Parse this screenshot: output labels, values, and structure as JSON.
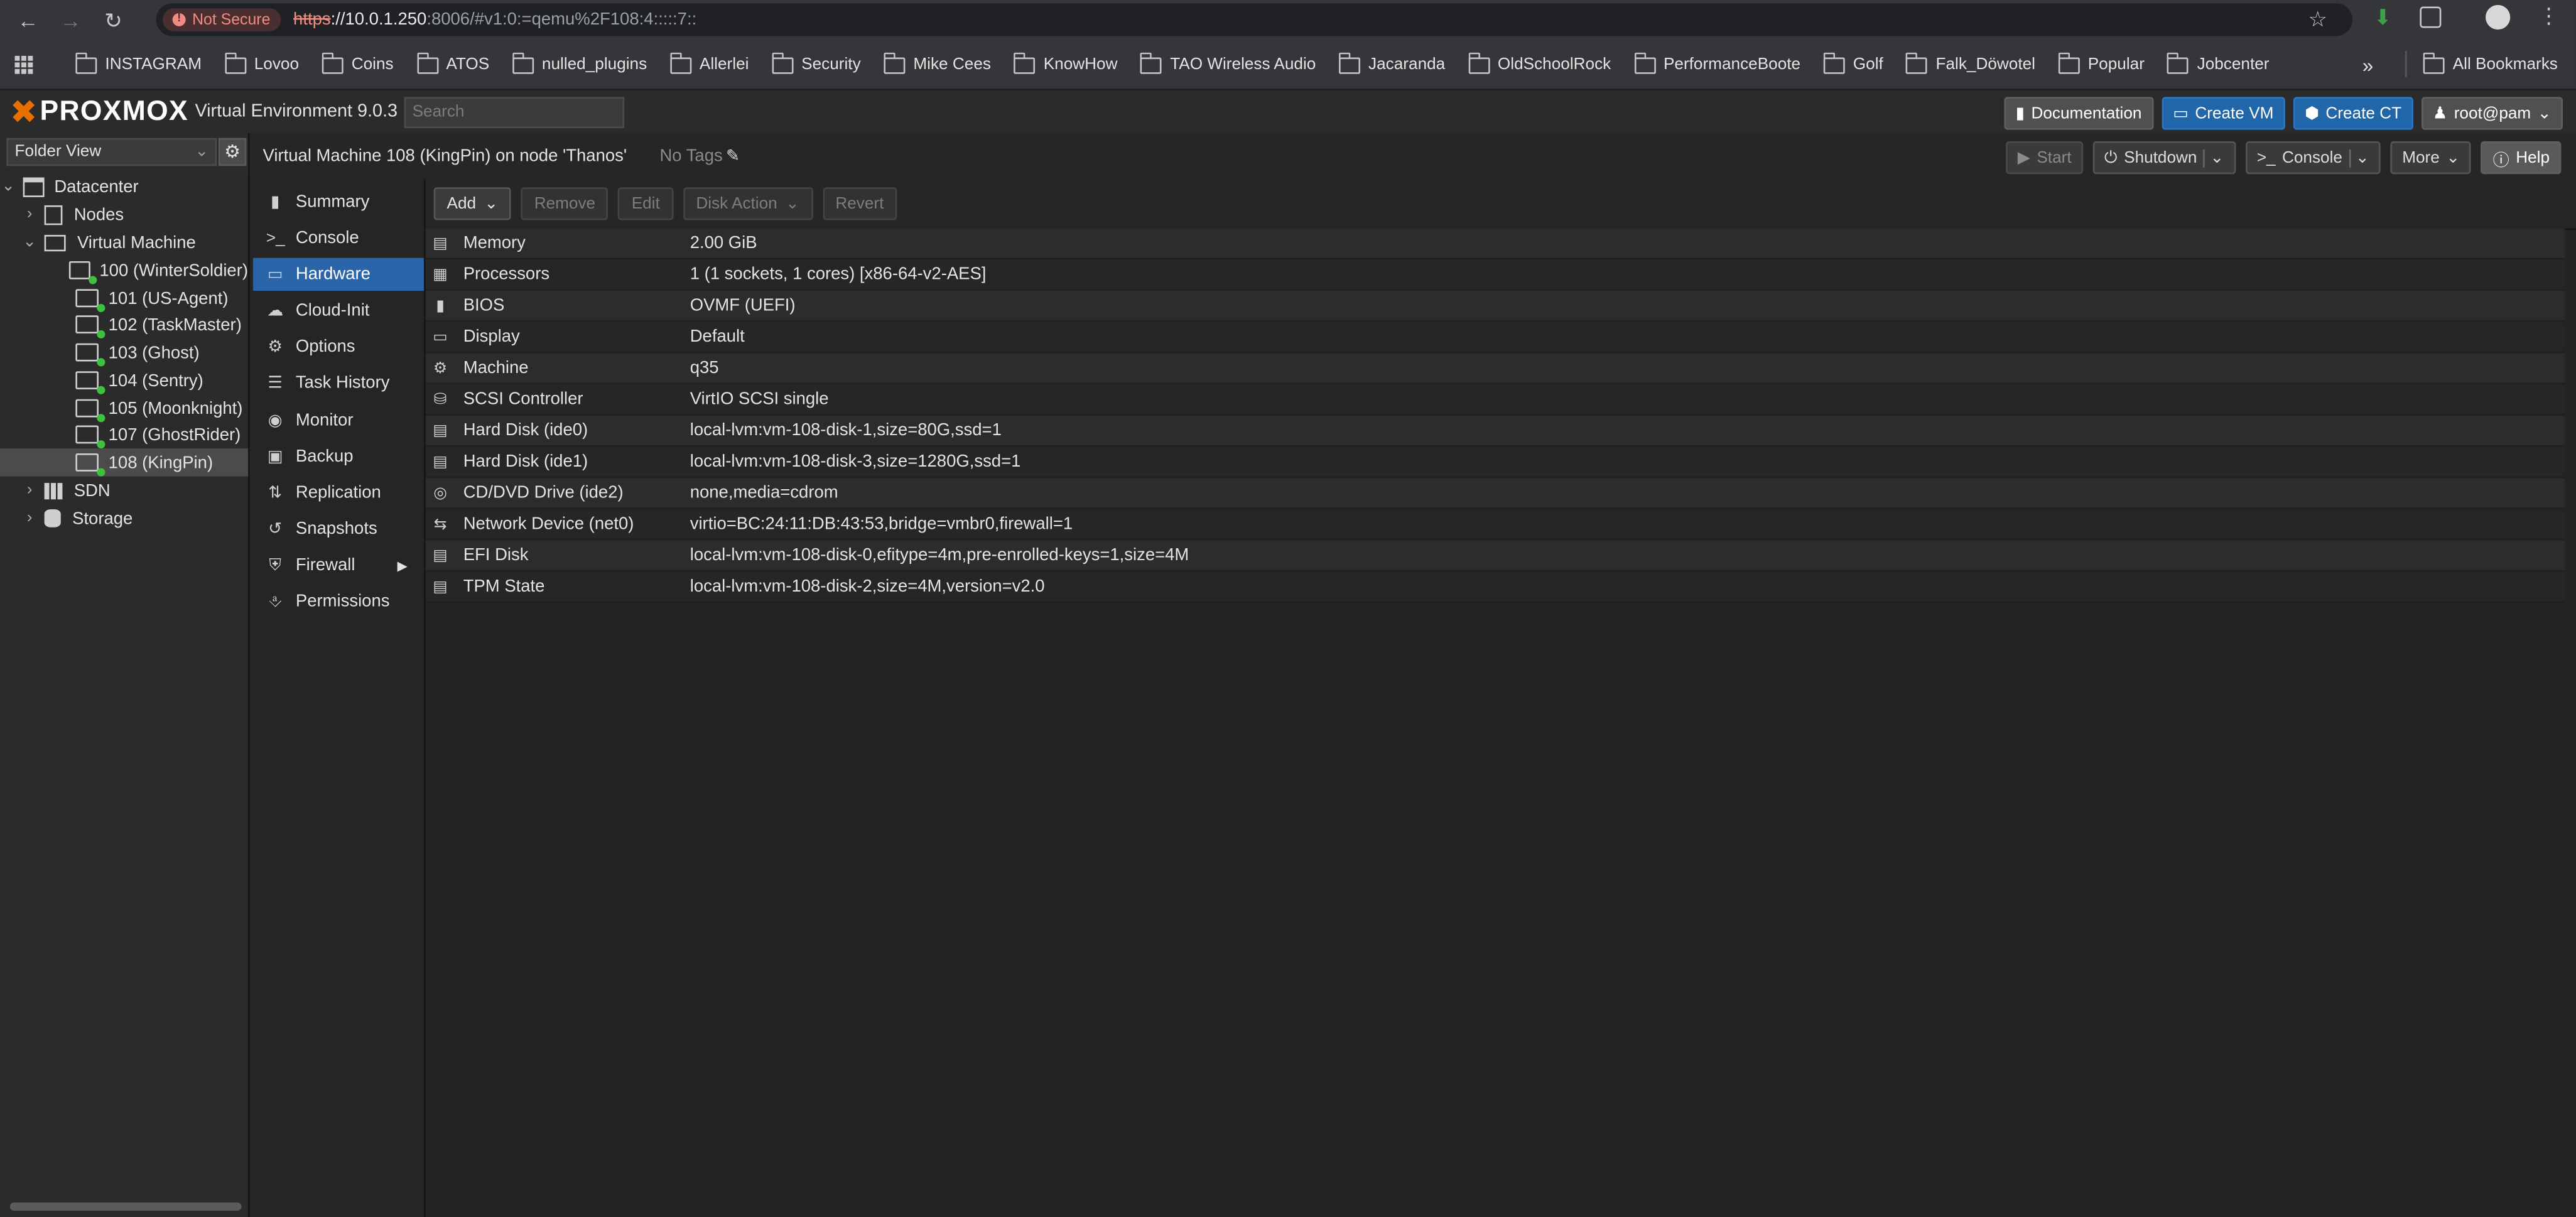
{
  "browser": {
    "security_chip": "Not Secure",
    "url_scheme": "https",
    "url_host": "://10.0.1.250",
    "url_rest": ":8006/#v1:0:=qemu%2F108:4:::::7::",
    "bookmarks": [
      "INSTAGRAM",
      "Lovoo",
      "Coins",
      "ATOS",
      "nulled_plugins",
      "Allerlei",
      "Security",
      "Mike Cees",
      "KnowHow",
      "TAO Wireless Audio",
      "Jacaranda",
      "OldSchoolRock",
      "PerformanceBoote",
      "Golf",
      "Falk_Döwotel",
      "Popular",
      "Jobcenter"
    ],
    "all_bookmarks": "All Bookmarks",
    "more_bookmarks": "»"
  },
  "header": {
    "logo": "PROXMOX",
    "product": "Virtual Environment 9.0.3",
    "search_placeholder": "Search",
    "documentation": "Documentation",
    "create_vm": "Create VM",
    "create_ct": "Create CT",
    "user": "root@pam"
  },
  "tree": {
    "view_select": "Folder View",
    "items": [
      {
        "label": "Datacenter"
      },
      {
        "label": "Nodes"
      },
      {
        "label": "Virtual Machine"
      },
      {
        "label": "100 (WinterSoldier)"
      },
      {
        "label": "101 (US-Agent)"
      },
      {
        "label": "102 (TaskMaster)"
      },
      {
        "label": "103 (Ghost)"
      },
      {
        "label": "104 (Sentry)"
      },
      {
        "label": "105 (Moonknight)"
      },
      {
        "label": "107 (GhostRider)"
      },
      {
        "label": "108 (KingPin)"
      },
      {
        "label": "SDN"
      },
      {
        "label": "Storage"
      }
    ]
  },
  "content": {
    "title": "Virtual Machine 108 (KingPin) on node 'Thanos'",
    "tags": "No Tags",
    "start": "Start",
    "shutdown": "Shutdown",
    "console": "Console",
    "more": "More",
    "help": "Help"
  },
  "menu": [
    {
      "label": "Summary",
      "icon": "book-icon"
    },
    {
      "label": "Console",
      "icon": "terminal-icon"
    },
    {
      "label": "Hardware",
      "icon": "monitor-icon"
    },
    {
      "label": "Cloud-Init",
      "icon": "cloud-icon"
    },
    {
      "label": "Options",
      "icon": "gear-icon"
    },
    {
      "label": "Task History",
      "icon": "list-icon"
    },
    {
      "label": "Monitor",
      "icon": "eye-icon"
    },
    {
      "label": "Backup",
      "icon": "floppy-icon"
    },
    {
      "label": "Replication",
      "icon": "retweet-icon"
    },
    {
      "label": "Snapshots",
      "icon": "history-icon"
    },
    {
      "label": "Firewall",
      "icon": "shield-icon"
    },
    {
      "label": "Permissions",
      "icon": "unlock-icon"
    }
  ],
  "toolbar": {
    "add": "Add",
    "remove": "Remove",
    "edit": "Edit",
    "disk_action": "Disk Action",
    "revert": "Revert"
  },
  "hardware": [
    {
      "name": "Memory",
      "value": "2.00 GiB",
      "icon": "memory-icon"
    },
    {
      "name": "Processors",
      "value": "1 (1 sockets, 1 cores) [x86-64-v2-AES]",
      "icon": "cpu-icon"
    },
    {
      "name": "BIOS",
      "value": "OVMF (UEFI)",
      "icon": "microchip-icon"
    },
    {
      "name": "Display",
      "value": "Default",
      "icon": "desktop-icon"
    },
    {
      "name": "Machine",
      "value": "q35",
      "icon": "cogs-icon"
    },
    {
      "name": "SCSI Controller",
      "value": "VirtIO SCSI single",
      "icon": "database-icon"
    },
    {
      "name": "Hard Disk (ide0)",
      "value": "local-lvm:vm-108-disk-1,size=80G,ssd=1",
      "icon": "hdd-icon"
    },
    {
      "name": "Hard Disk (ide1)",
      "value": "local-lvm:vm-108-disk-3,size=1280G,ssd=1",
      "icon": "hdd-icon"
    },
    {
      "name": "CD/DVD Drive (ide2)",
      "value": "none,media=cdrom",
      "icon": "cdrom-icon"
    },
    {
      "name": "Network Device (net0)",
      "value": "virtio=BC:24:11:DB:43:53,bridge=vmbr0,firewall=1",
      "icon": "exchange-icon"
    },
    {
      "name": "EFI Disk",
      "value": "local-lvm:vm-108-disk-0,efitype=4m,pre-enrolled-keys=1,size=4M",
      "icon": "hdd-icon"
    },
    {
      "name": "TPM State",
      "value": "local-lvm:vm-108-disk-2,size=4M,version=v2.0",
      "icon": "hdd-icon"
    }
  ]
}
